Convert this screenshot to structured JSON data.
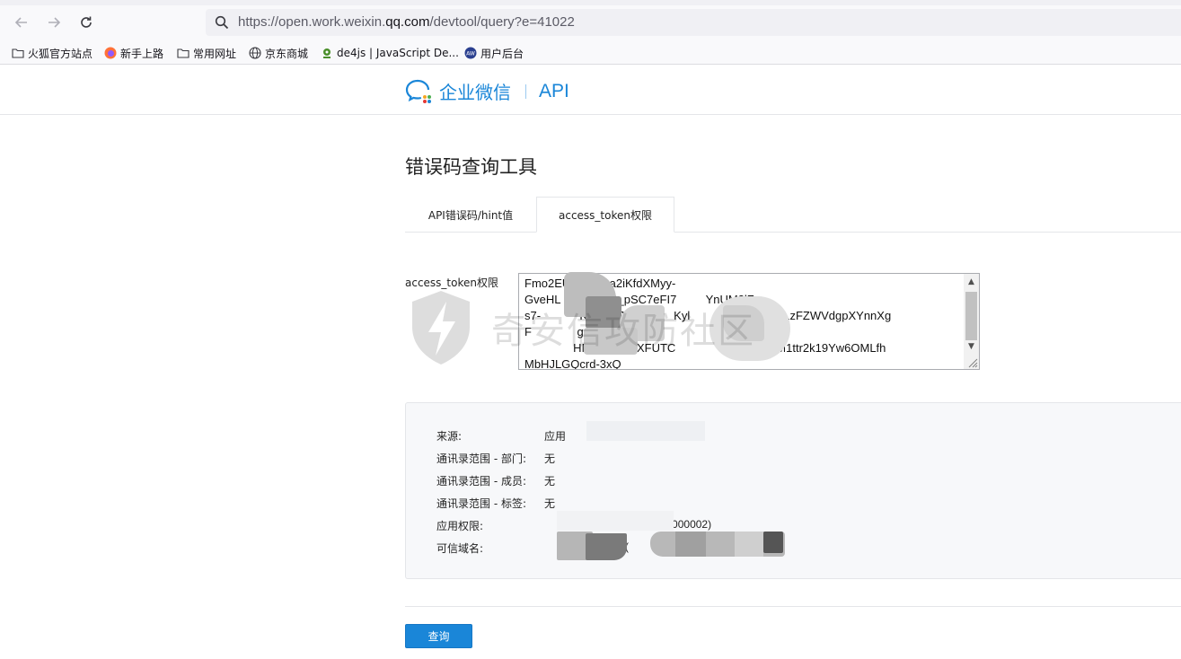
{
  "browser": {
    "url_prefix": "https://open.work.weixin.",
    "url_domain": "qq.com",
    "url_suffix": "/devtool/query?e=41022",
    "bookmarks": [
      {
        "label": "火狐官方站点",
        "icon": "folder-icon"
      },
      {
        "label": "新手上路",
        "icon": "firefox-icon"
      },
      {
        "label": "常用网址",
        "icon": "folder-icon"
      },
      {
        "label": "京东商城",
        "icon": "globe-icon"
      },
      {
        "label": "de4js | JavaScript De...",
        "icon": "de4js-icon"
      },
      {
        "label": "用户后台",
        "icon": "user-backend-icon"
      }
    ]
  },
  "header": {
    "logo_text": "企业微信",
    "api_text": "API"
  },
  "page": {
    "title": "错误码查询工具",
    "tabs": [
      {
        "label": "API错误码/hint值",
        "active": false
      },
      {
        "label": "access_token权限",
        "active": true
      }
    ]
  },
  "form": {
    "field_label": "access_token权限",
    "token_value": "Fmo2EU          0a2iKfdXMyy-\nGveHL               C_pSC7eFI7         YnUM3lZu-\ns7-            KHRUyJ0YQ        Kyl        UKH2GyNenLzFZWVdgpXYnnXg\nF              guqRTUu-\n               HMsen3nAcXFUTC                4WbCbrzM1ttr2k19Yw6OMLfh\nMbHJLGQcrd-3xQ"
  },
  "result": {
    "rows": [
      {
        "key": "来源:",
        "value": "应用"
      },
      {
        "key": "通讯录范围 - 部门:",
        "value": "无"
      },
      {
        "key": "通讯录范围 - 成员:",
        "value": "无"
      },
      {
        "key": "通讯录范围 - 标签:",
        "value": "无"
      },
      {
        "key": "应用权限:",
        "value": "                         (AgentId: 1000002)"
      },
      {
        "key": "可信域名:",
        "value": "                    om  (                           )"
      }
    ]
  },
  "actions": {
    "query_label": "查询"
  },
  "watermark": {
    "text": "奇安信攻防社区"
  },
  "colors": {
    "accent": "#1a86d8",
    "border": "#e4e6e9",
    "panel_bg": "#f7f8fa"
  }
}
